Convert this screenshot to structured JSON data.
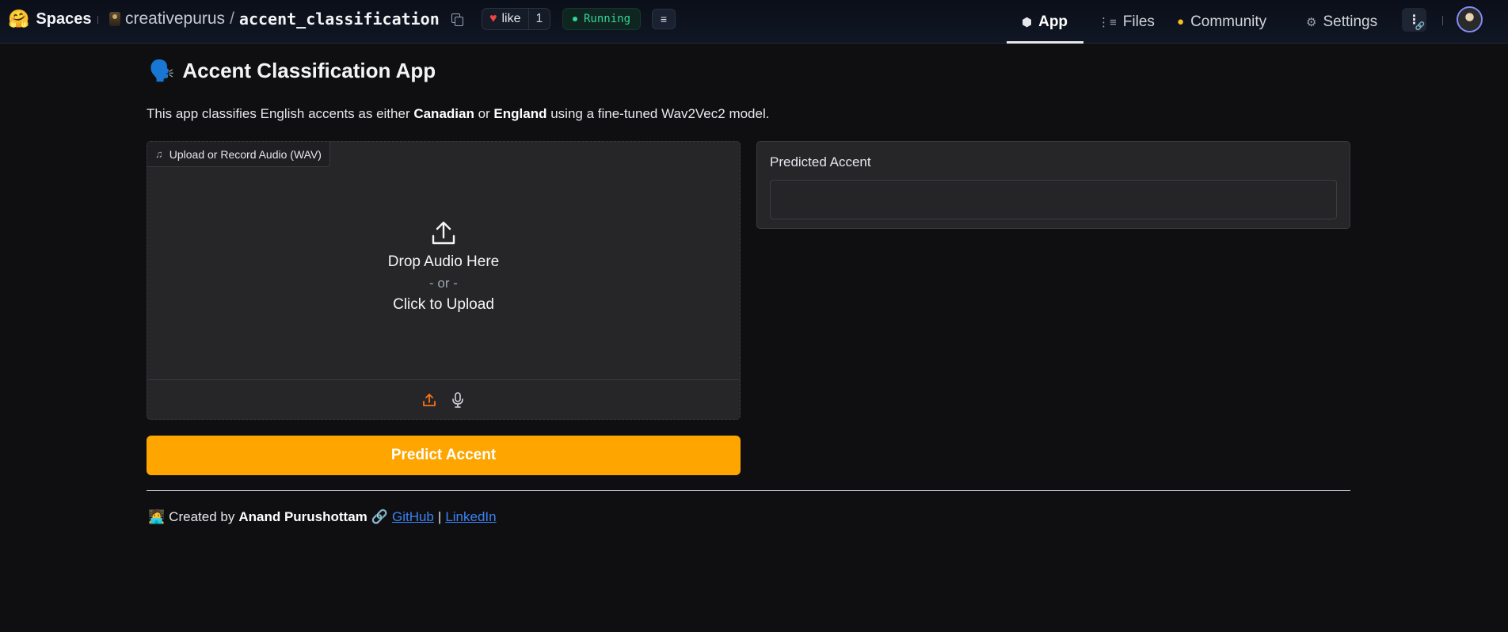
{
  "header": {
    "brand": {
      "logo": "🤗",
      "text": "Spaces"
    },
    "repo": {
      "owner": "creativepurus",
      "slash": "/",
      "name": "accent_classification"
    },
    "like": {
      "label": "like",
      "count": "1"
    },
    "status": "Running",
    "nav": [
      {
        "label": "App",
        "icon": "cube-icon",
        "active": true
      },
      {
        "label": "Files",
        "icon": "files-icon"
      },
      {
        "label": "Community",
        "icon": "community-icon"
      },
      {
        "label": "Settings",
        "icon": "gear-icon"
      }
    ]
  },
  "app": {
    "title_emoji": "🗣️",
    "title": "Accent Classification App",
    "desc": {
      "pre": "This app classifies English accents as either ",
      "bold1": "Canadian",
      "mid": " or ",
      "bold2": "England",
      "post": " using a fine-tuned Wav2Vec2 model."
    },
    "audio_input": {
      "label": "Upload or Record Audio (WAV)",
      "drop_text": "Drop Audio Here",
      "or_text": "- or -",
      "click_text": "Click to Upload"
    },
    "predict_button": "Predict Accent",
    "output": {
      "label": "Predicted Accent",
      "value": ""
    }
  },
  "footer": {
    "emoji": "🧑‍💻",
    "created_by": "Created by",
    "author": "Anand Purushottam",
    "link_emoji": "🔗",
    "github": "GitHub",
    "divider": "|",
    "linkedin": "LinkedIn"
  },
  "colors": {
    "accent": "#ffa500",
    "status_green": "#34d399",
    "link_blue": "#3b82f6"
  }
}
